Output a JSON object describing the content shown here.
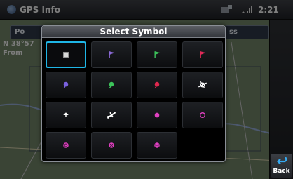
{
  "header": {
    "title": "GPS Info",
    "time": "2:21",
    "title_icon": "gps-info-icon",
    "status_icons": [
      "gps-icon",
      "signal-strength-icon"
    ]
  },
  "background": {
    "tab_left_label": "Po",
    "tab_right_label": "ss",
    "coordinate_text": "N 38°57",
    "from_text": "From"
  },
  "dialog": {
    "title": "Select Symbol",
    "selected_index": 0,
    "symbols": [
      {
        "name": "square-symbol-icon",
        "color": "#d9d9d9"
      },
      {
        "name": "purple-flag-icon",
        "color": "#8c6ad8"
      },
      {
        "name": "green-flag-icon",
        "color": "#3cbf5a"
      },
      {
        "name": "red-flag-icon",
        "color": "#e02a58"
      },
      {
        "name": "purple-pin-icon",
        "color": "#7a62e0"
      },
      {
        "name": "green-pin-icon",
        "color": "#3cc45a"
      },
      {
        "name": "red-pin-icon",
        "color": "#e0284e"
      },
      {
        "name": "airport-symbol-icon",
        "color": "#ffffff"
      },
      {
        "name": "heliport-symbol-icon",
        "color": "#ffffff"
      },
      {
        "name": "airplane-symbol-icon",
        "color": "#ffffff"
      },
      {
        "name": "magenta-dot-icon",
        "color": "#e040c0"
      },
      {
        "name": "magenta-ring-icon",
        "color": "#e040c0"
      },
      {
        "name": "private-airport-magenta-icon",
        "color": "#e040c0"
      },
      {
        "name": "restricted-airport-magenta-icon",
        "color": "#e040c0"
      },
      {
        "name": "heliport-magenta-icon",
        "color": "#e040c0"
      }
    ]
  },
  "back_button": {
    "label": "Back",
    "icon": "back-arrow-icon",
    "color": "#35a9f0"
  }
}
